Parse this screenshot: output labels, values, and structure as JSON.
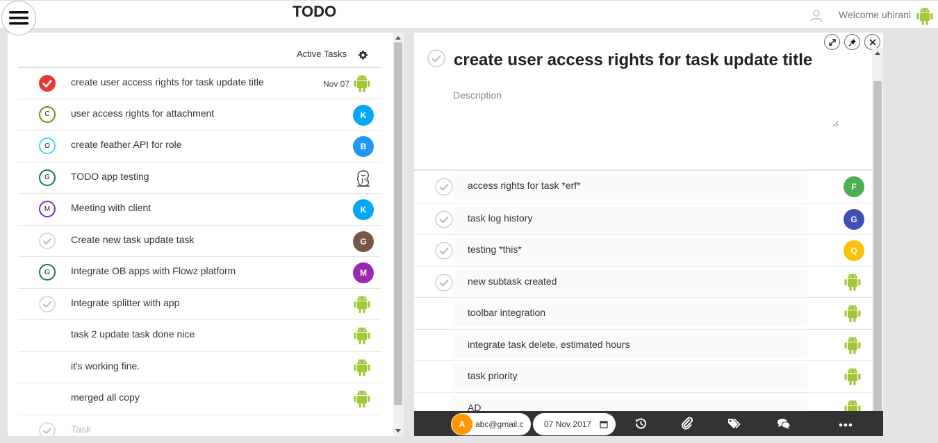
{
  "header": {
    "title": "TODO",
    "welcome": "Welcome uhirani"
  },
  "left": {
    "section_label": "Active Tasks",
    "tasks": [
      {
        "title": "create user access rights for task update title",
        "date": "Nov 07",
        "status": "done",
        "assignee": "android"
      },
      {
        "title": "user access rights for attachment",
        "status": "C",
        "status_color": "#8a7d1e",
        "assignee": "K",
        "assignee_color": "#03a9f4"
      },
      {
        "title": "create feather API for role",
        "status": "O",
        "status_color": "#3ee0f0",
        "assignee": "B",
        "assignee_color": "#2196f3"
      },
      {
        "title": "TODO app testing",
        "status": "G",
        "status_color": "#1b7a3d",
        "assignee": "ganesha"
      },
      {
        "title": " Meeting with client",
        "status": "M",
        "status_color": "#7b2fbf",
        "assignee": "K",
        "assignee_color": "#03a9f4"
      },
      {
        "title": "Create new task update task",
        "status": "check",
        "assignee": "G",
        "assignee_color": "#795548"
      },
      {
        "title": "Integrate OB apps with Flowz platform",
        "status": "G",
        "status_color": "#1b7a3d",
        "assignee": "M",
        "assignee_color": "#9c27b0"
      },
      {
        "title": "Integrate splitter with app",
        "status": "check",
        "assignee": "android"
      },
      {
        "title": "task 2 update task done nice",
        "status": "none",
        "assignee": "android"
      },
      {
        "title": "it's working fine.",
        "status": "none",
        "assignee": "android"
      },
      {
        "title": "merged all copy",
        "status": "none",
        "assignee": "android"
      }
    ],
    "new_task_placeholder": "Task"
  },
  "detail": {
    "title": "create user access rights for task update title",
    "description_placeholder": "Description",
    "subtasks": [
      {
        "title": "access rights for task *erf*",
        "check": true,
        "assignee": "F",
        "assignee_color": "#4caf50"
      },
      {
        "title": "task log history",
        "check": true,
        "assignee": "G",
        "assignee_color": "#3f51b5"
      },
      {
        "title": "testing *this*",
        "check": true,
        "assignee": "Q",
        "assignee_color": "#ffc107"
      },
      {
        "title": "new subtask created",
        "check": true,
        "assignee": "android"
      },
      {
        "title": "toolbar integration",
        "check": false,
        "assignee": "android"
      },
      {
        "title": "integrate task delete, estimated hours",
        "check": false,
        "assignee": "android"
      },
      {
        "title": "task priority",
        "check": false,
        "assignee": "android"
      },
      {
        "title": "AD",
        "check": false,
        "assignee": "android"
      }
    ],
    "bottom": {
      "assignee_initial": "A",
      "assignee_color": "#ff9800",
      "assignee_email": "abc@gmail.c",
      "due_date": "07 Nov 2017"
    }
  },
  "colors": {
    "android": "#a4c639",
    "done_red": "#e53935"
  }
}
